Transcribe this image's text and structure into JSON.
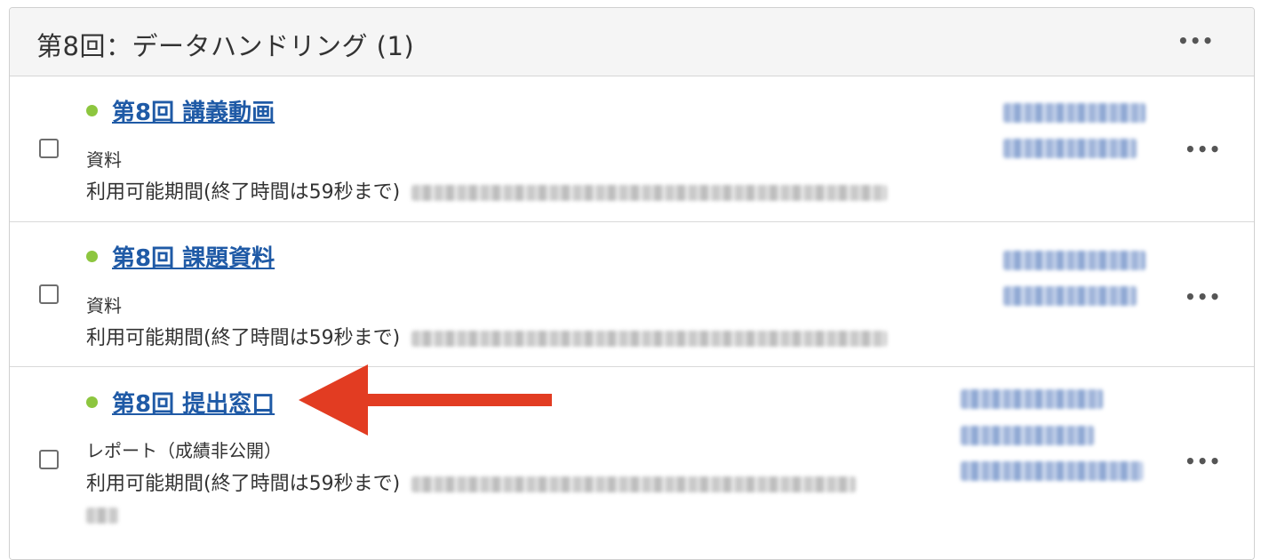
{
  "section": {
    "title": "第8回：データハンドリング (1)",
    "menu_icon": "ellipsis-icon"
  },
  "items": [
    {
      "title": "第8回 講義動画",
      "type": "資料",
      "availability_label": "利用可能期間(終了時間は59秒まで)",
      "status_color": "#8dc63f"
    },
    {
      "title": "第8回 課題資料",
      "type": "資料",
      "availability_label": "利用可能期間(終了時間は59秒まで)",
      "status_color": "#8dc63f"
    },
    {
      "title": "第8回 提出窓口",
      "type": "レポート（成績非公開）",
      "availability_label": "利用可能期間(終了時間は59秒まで)",
      "status_color": "#8dc63f"
    }
  ],
  "colors": {
    "link": "#1f5aa6",
    "annotation_arrow": "#e23c22",
    "header_bg": "#f5f5f5"
  }
}
